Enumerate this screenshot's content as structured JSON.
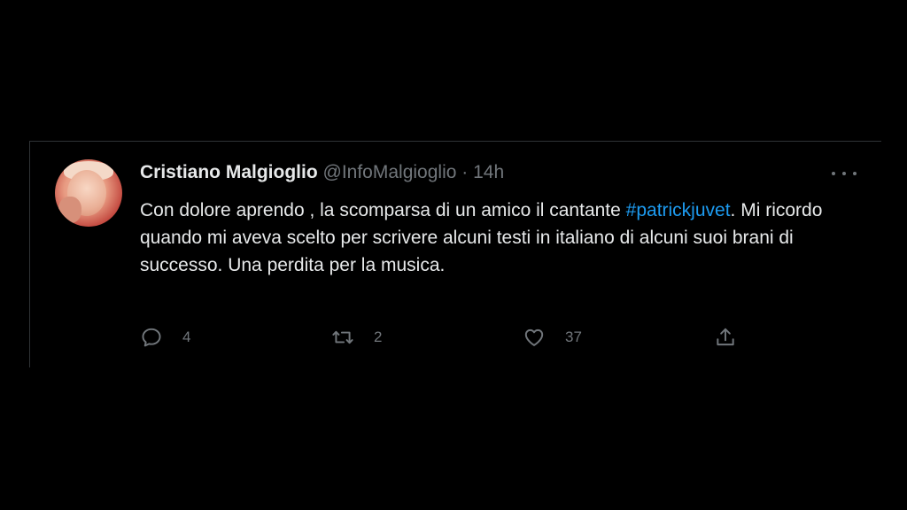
{
  "tweet": {
    "author_name": "Cristiano Malgioglio",
    "handle": "@InfoMalgioglio",
    "separator": "·",
    "time": "14h",
    "text_before_hashtag": "Con dolore aprendo , la scomparsa di un amico il cantante ",
    "hashtag": "#patrickjuvet",
    "text_after_hashtag": ". Mi ricordo quando mi aveva scelto per scrivere alcuni testi in italiano di alcuni suoi brani di successo. Una perdita per la musica.",
    "reply_count": "4",
    "retweet_count": "2",
    "like_count": "37"
  },
  "icons": {
    "reply": "comment-bubble-icon",
    "retweet": "retweet-arrows-icon",
    "like": "heart-icon",
    "share": "share-upload-icon",
    "more": "more-dots-icon"
  },
  "colors": {
    "background": "#000000",
    "text": "#e7e9ea",
    "muted": "#71767b",
    "link": "#1d9bf0",
    "border": "#2f3336"
  }
}
